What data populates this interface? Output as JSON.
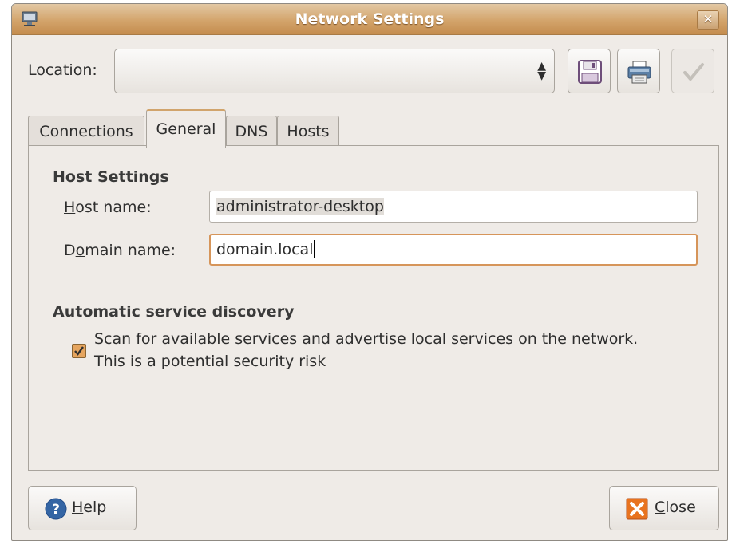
{
  "window": {
    "title": "Network Settings"
  },
  "location": {
    "label": "Location:",
    "value": ""
  },
  "tabs": [
    {
      "label": "Connections",
      "active": false
    },
    {
      "label": "General",
      "active": true
    },
    {
      "label": "DNS",
      "active": false
    },
    {
      "label": "Hosts",
      "active": false
    }
  ],
  "host_settings": {
    "heading": "Host Settings",
    "host_name": {
      "label_mnemonic": "H",
      "label_rest": "ost name:",
      "value": "administrator-desktop"
    },
    "domain_name": {
      "label_prefix": "D",
      "label_mnemonic": "o",
      "label_rest": "main name:",
      "value": "domain.local"
    }
  },
  "service_discovery": {
    "heading": "Automatic service discovery",
    "checked": true,
    "line1": "Scan for available services and advertise local services on the network.",
    "line2": "This is a potential security risk"
  },
  "buttons": {
    "help": {
      "mnemonic": "H",
      "rest": "elp"
    },
    "close": {
      "mnemonic": "C",
      "rest": "lose"
    }
  },
  "icons": {
    "app": "network-icon",
    "save": "floppy-disk-icon",
    "delete": "printer-icon",
    "apply": "checkmark-icon",
    "help": "help-question-icon",
    "close": "close-x-icon"
  },
  "colors": {
    "accent": "#d6955a",
    "title_bar": "#d3a46b",
    "help_icon": "#3465a4",
    "close_icon": "#e8731f"
  }
}
